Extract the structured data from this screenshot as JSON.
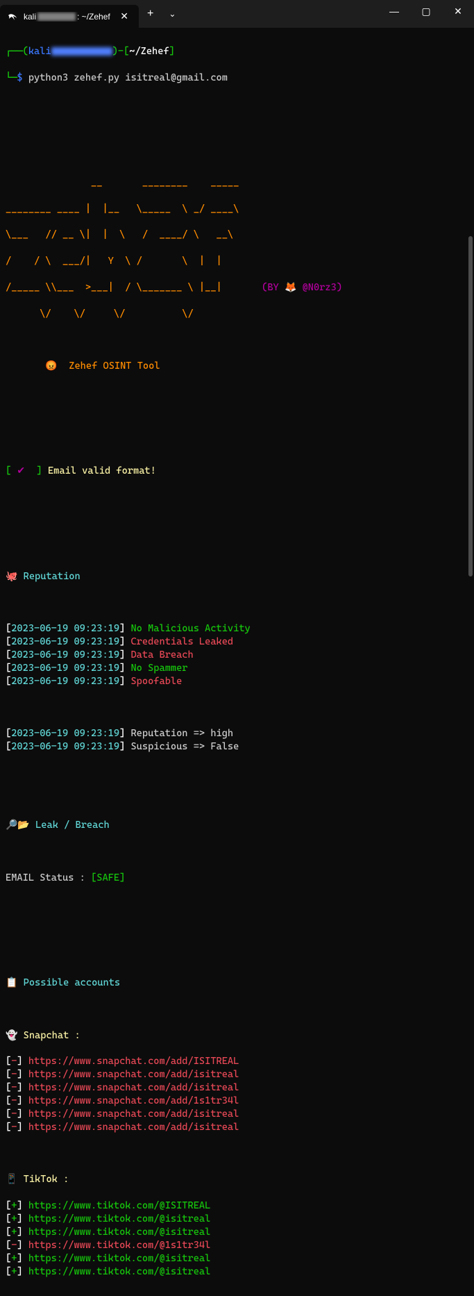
{
  "window": {
    "tab_prefix": "kali",
    "tab_suffix": ": ~/Zehef",
    "new_tab": "+",
    "dropdown": "⌄",
    "minimize": "—",
    "maximize": "▢",
    "close": "✕"
  },
  "prompt": {
    "user": "kali",
    "sep": "㉿",
    "path": "~/Zehef",
    "symbol": "$",
    "command": "python3 zehef.py isitreal@gmail.com"
  },
  "ascii": {
    "l1": "               __       ________    _____",
    "l2": "________ ____ |  |__   \\_____  \\ _/ ____\\",
    "l3": "\\___   // __ \\|  |  \\   /  ____/ \\   __\\",
    "l4": "/    / \\  ___/|   Y  \\ /       \\  |  |",
    "l5": "/_____ \\\\___  >___|  / \\_______ \\ |__|",
    "l6": "      \\/    \\/     \\/          \\/",
    "by_pre": "(BY ",
    "by_emoji": "🦊",
    "by_handle": " @N0rz3)"
  },
  "tool": {
    "emoji": "😡",
    "name": "Zehef OSINT Tool"
  },
  "validation": {
    "check": "✔",
    "msg": "Email valid format!"
  },
  "reputation": {
    "emoji": "🐙",
    "title": "Reputation",
    "ts": "2023-06-19 09:23:19",
    "items": [
      {
        "text": "No Malicious Activity",
        "good": true
      },
      {
        "text": "Credentials Leaked",
        "good": false
      },
      {
        "text": "Data Breach",
        "good": false
      },
      {
        "text": "No Spammer",
        "good": true
      },
      {
        "text": "Spoofable",
        "good": false
      }
    ],
    "summary": [
      "Reputation => high",
      "Suspicious => False"
    ]
  },
  "leak": {
    "emoji": "🔎📂",
    "title": "Leak / Breach",
    "status_label": "EMAIL Status : ",
    "status_value": "[SAFE]"
  },
  "accounts": {
    "emoji": "📋",
    "title": "Possible accounts",
    "snapchat": {
      "emoji": "👻",
      "label": "Snapchat :",
      "items": [
        {
          "mark": "-",
          "url": "https://www.snapchat.com/add/ISITREAL"
        },
        {
          "mark": "-",
          "url": "https://www.snapchat.com/add/isitreal"
        },
        {
          "mark": "-",
          "url": "https://www.snapchat.com/add/isitreal"
        },
        {
          "mark": "-",
          "url": "https://www.snapchat.com/add/1s1tr34l"
        },
        {
          "mark": "-",
          "url": "https://www.snapchat.com/add/isitreal"
        },
        {
          "mark": "-",
          "url": "https://www.snapchat.com/add/isitreal"
        }
      ]
    },
    "tiktok": {
      "emoji": "📱",
      "label": "TikTok :",
      "items": [
        {
          "mark": "+",
          "url": "https://www.tiktok.com/@ISITREAL"
        },
        {
          "mark": "+",
          "url": "https://www.tiktok.com/@isitreal"
        },
        {
          "mark": "+",
          "url": "https://www.tiktok.com/@isitreal"
        },
        {
          "mark": "-",
          "url": "https://www.tiktok.com/@1s1tr34l"
        },
        {
          "mark": "+",
          "url": "https://www.tiktok.com/@isitreal"
        },
        {
          "mark": "+",
          "url": "https://www.tiktok.com/@isitreal"
        }
      ]
    }
  }
}
